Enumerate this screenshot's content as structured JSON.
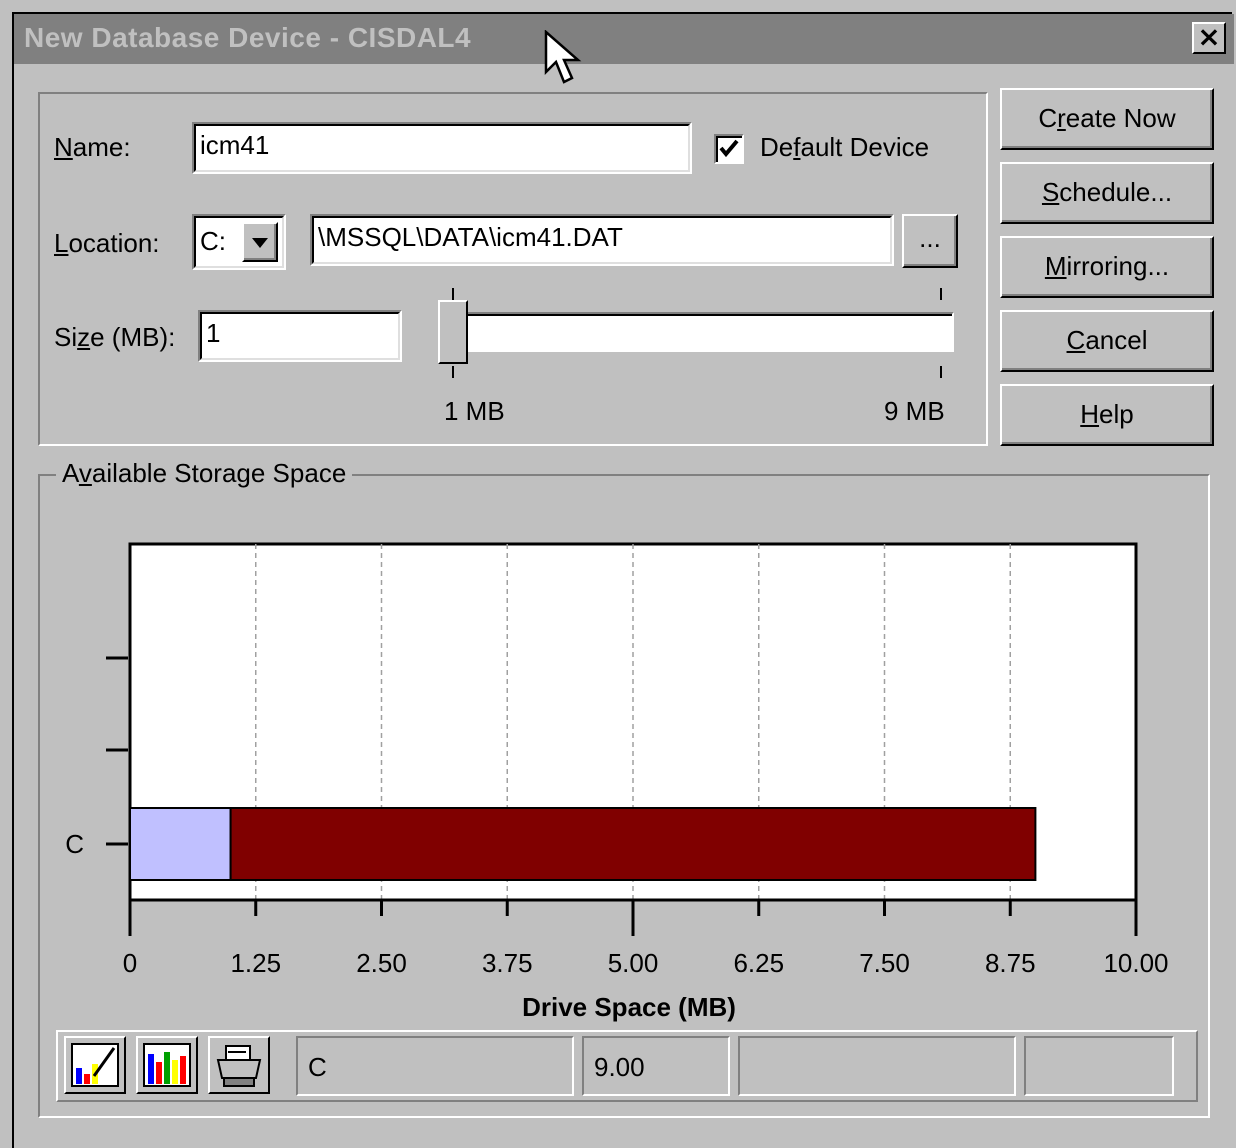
{
  "window": {
    "title": "New Database Device - CISDAL4",
    "close_label": "×"
  },
  "form": {
    "name_label": "Name:",
    "name_value": "icm41",
    "default_device_label": "Default Device",
    "default_device_checked": true,
    "location_label": "Location:",
    "location_drive": "C:",
    "location_path": "\\MSSQL\\DATA\\icm41.DAT",
    "browse_label": "...",
    "size_label": "Size (MB):",
    "size_value": "1",
    "slider_min_label": "1 MB",
    "slider_max_label": "9 MB",
    "slider_position_fraction": 0.0
  },
  "buttons": {
    "create_now": "Create Now",
    "schedule": "Schedule...",
    "mirroring": "Mirroring...",
    "cancel": "Cancel",
    "help": "Help"
  },
  "storage": {
    "group_label": "Available Storage Space"
  },
  "chart_data": {
    "type": "bar",
    "orientation": "horizontal",
    "stacked": true,
    "categories": [
      "C"
    ],
    "series": [
      {
        "values": [
          1.0
        ],
        "color": "#c0c0ff"
      },
      {
        "values": [
          8.0
        ],
        "color": "#800000"
      }
    ],
    "xlabel": "Drive Space (MB)",
    "xlim": [
      0,
      10
    ],
    "xticks": [
      "0",
      "1.25",
      "2.50",
      "3.75",
      "5.00",
      "6.25",
      "7.50",
      "8.75",
      "10.00"
    ],
    "grid": true
  },
  "statusbar": {
    "cell1": "C",
    "cell2": "9.00",
    "cell3": "",
    "cell4": ""
  },
  "colors": {
    "titlebar_bg": "#808080",
    "titlebar_text": "#c0c0c0",
    "dialog_bg": "#c0c0c0"
  }
}
